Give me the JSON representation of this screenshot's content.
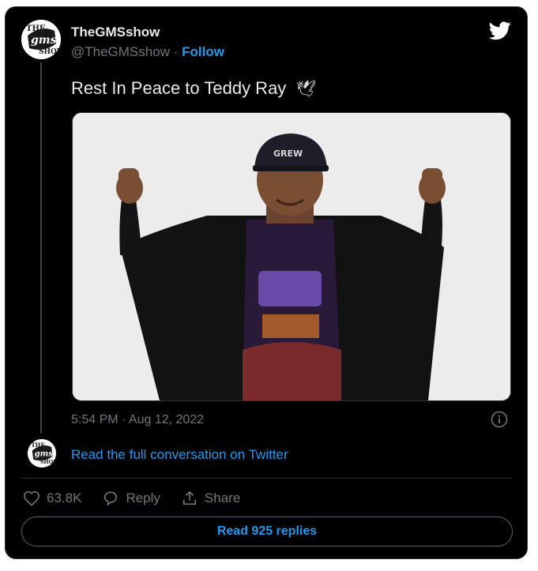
{
  "tweet": {
    "author_name": "TheGMSshow",
    "handle": "@TheGMSshow",
    "separator": "·",
    "follow_label": "Follow",
    "text": "Rest In Peace to Teddy Ray",
    "emoji": "🕊",
    "timestamp": "5:54 PM · Aug 12, 2022",
    "avatar_logo_top": "THE",
    "avatar_logo_mid": "gms",
    "avatar_logo_bottom": "SHOW"
  },
  "conversation": {
    "link_label": "Read the full conversation on Twitter"
  },
  "actions": {
    "likes": "63.8K",
    "reply_label": "Reply",
    "share_label": "Share"
  },
  "replies_button": {
    "label": "Read 925 replies"
  },
  "photo": {
    "cap_text": "GREW"
  },
  "icons": {
    "brand": "twitter-bird-icon",
    "info": "info-icon",
    "like": "heart-icon",
    "reply": "reply-bubble-icon",
    "share": "share-upload-icon"
  },
  "colors": {
    "background": "#000000",
    "text": "#e7e9ea",
    "muted": "#71767b",
    "accent": "#1d9bf0",
    "border": "#2f3336"
  }
}
